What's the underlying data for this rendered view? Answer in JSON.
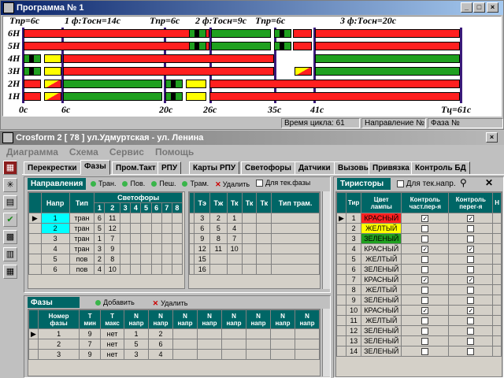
{
  "window1": {
    "title": "Программа № 1",
    "phase_headers": [
      "Tпр=6с",
      "1 ф:Tосн=14с",
      "Tпр=6с",
      "2 ф:Tосн=9с",
      "Tпр=6с",
      "3 ф:Tосн=20с"
    ],
    "rows": [
      "6H",
      "5H",
      "4H",
      "3H",
      "2H",
      "1H"
    ],
    "time_labels": [
      "0с",
      "6с",
      "20с",
      "26с",
      "35с",
      "41с",
      "Tц=61с"
    ],
    "status": {
      "cycle": "Время цикла: 61",
      "direction": "Направление №",
      "phase": "Фаза №"
    },
    "cycle_seconds": 61,
    "signal_colors": {
      "red": "#ff1f1f",
      "green": "#1fa01f",
      "yellow": "#ffff00",
      "black": "#000000"
    }
  },
  "window2": {
    "title": "Crosform 2 [ 78 ] ул.Удмуртская  - ул. Ленина",
    "menu": [
      "Диаграмма",
      "Схема",
      "Сервис",
      "Помощь"
    ],
    "tabs": [
      "Перекрестки",
      "Фазы",
      "Пром.Такт",
      "РПУ",
      "Карты РПУ",
      "Светофоры",
      "Датчики",
      "Вызовы",
      "Привязка",
      "Контроль БД"
    ],
    "active_tab": "Фазы",
    "directions": {
      "title": "Направления",
      "actions": [
        "Тран.",
        "Пов.",
        "Пеш.",
        "Трам.",
        "Удалить"
      ],
      "current_phase_check": "Для тек.фазы",
      "columns": [
        "Напр",
        "Тип",
        "Светофоры"
      ],
      "svetofor_nums": [
        "1",
        "2",
        "3",
        "4",
        "5",
        "6",
        "7",
        "8"
      ],
      "rows": [
        {
          "n": "1",
          "type": "тран",
          "s": [
            "6",
            "11"
          ]
        },
        {
          "n": "2",
          "type": "тран",
          "s": [
            "5",
            "12"
          ]
        },
        {
          "n": "3",
          "type": "тран",
          "s": [
            "1",
            "7"
          ]
        },
        {
          "n": "4",
          "type": "тран",
          "s": [
            "3",
            "9"
          ]
        },
        {
          "n": "5",
          "type": "пов",
          "s": [
            "2",
            "8"
          ]
        },
        {
          "n": "6",
          "type": "пов",
          "s": [
            "4",
            "10"
          ]
        }
      ],
      "tram_columns": [
        "Тэ",
        "Тж",
        "Тк",
        "Тк",
        "Тк",
        "Тип трам."
      ],
      "tram_rows": [
        [
          "3",
          "2",
          "1"
        ],
        [
          "6",
          "5",
          "4"
        ],
        [
          "9",
          "8",
          "7"
        ],
        [
          "12",
          "11",
          "10"
        ],
        [
          "15",
          "",
          ""
        ],
        [
          "16",
          "",
          ""
        ]
      ]
    },
    "phases": {
      "title": "Фазы",
      "add": "Добавить",
      "delete": "Удалить",
      "columns": [
        "Номер фазы",
        "T мин",
        "T макс",
        "N напр",
        "N напр",
        "N напр",
        "N напр",
        "N напр",
        "N напр",
        "N напр",
        "N напр"
      ],
      "rows": [
        [
          "1",
          "9",
          "нет",
          "1",
          "2"
        ],
        [
          "2",
          "7",
          "нет",
          "5",
          "6"
        ],
        [
          "3",
          "9",
          "нет",
          "3",
          "4"
        ]
      ]
    },
    "thyristors": {
      "title": "Тиристоры",
      "check": "Для тек.напр.",
      "columns": [
        "Тир",
        "Цвет лампы",
        "Контроль част.пер-я",
        "Контроль перег-я",
        "Н"
      ],
      "rows": [
        {
          "n": "1",
          "color": "КРАСНЫЙ",
          "c1": true,
          "c2": true,
          "hl": "#ff2020"
        },
        {
          "n": "2",
          "color": "ЖЕЛТЫЙ",
          "c1": false,
          "c2": false,
          "hl": "#ffff00"
        },
        {
          "n": "3",
          "color": "ЗЕЛЕНЫЙ",
          "c1": false,
          "c2": false,
          "hl": "#20a020"
        },
        {
          "n": "4",
          "color": "КРАСНЫЙ",
          "c1": true,
          "c2": true,
          "hl": ""
        },
        {
          "n": "5",
          "color": "ЖЕЛТЫЙ",
          "c1": false,
          "c2": false,
          "hl": ""
        },
        {
          "n": "6",
          "color": "ЗЕЛЕНЫЙ",
          "c1": false,
          "c2": false,
          "hl": ""
        },
        {
          "n": "7",
          "color": "КРАСНЫЙ",
          "c1": true,
          "c2": true,
          "hl": ""
        },
        {
          "n": "8",
          "color": "ЖЕЛТЫЙ",
          "c1": false,
          "c2": false,
          "hl": ""
        },
        {
          "n": "9",
          "color": "ЗЕЛЕНЫЙ",
          "c1": false,
          "c2": false,
          "hl": ""
        },
        {
          "n": "10",
          "color": "КРАСНЫЙ",
          "c1": true,
          "c2": true,
          "hl": ""
        },
        {
          "n": "11",
          "color": "ЖЕЛТЫЙ",
          "c1": false,
          "c2": false,
          "hl": ""
        },
        {
          "n": "12",
          "color": "ЗЕЛЕНЫЙ",
          "c1": false,
          "c2": false,
          "hl": ""
        },
        {
          "n": "13",
          "color": "ЗЕЛЕНЫЙ",
          "c1": false,
          "c2": false,
          "hl": ""
        },
        {
          "n": "14",
          "color": "ЗЕЛЕНЫЙ",
          "c1": false,
          "c2": false,
          "hl": ""
        }
      ]
    }
  }
}
